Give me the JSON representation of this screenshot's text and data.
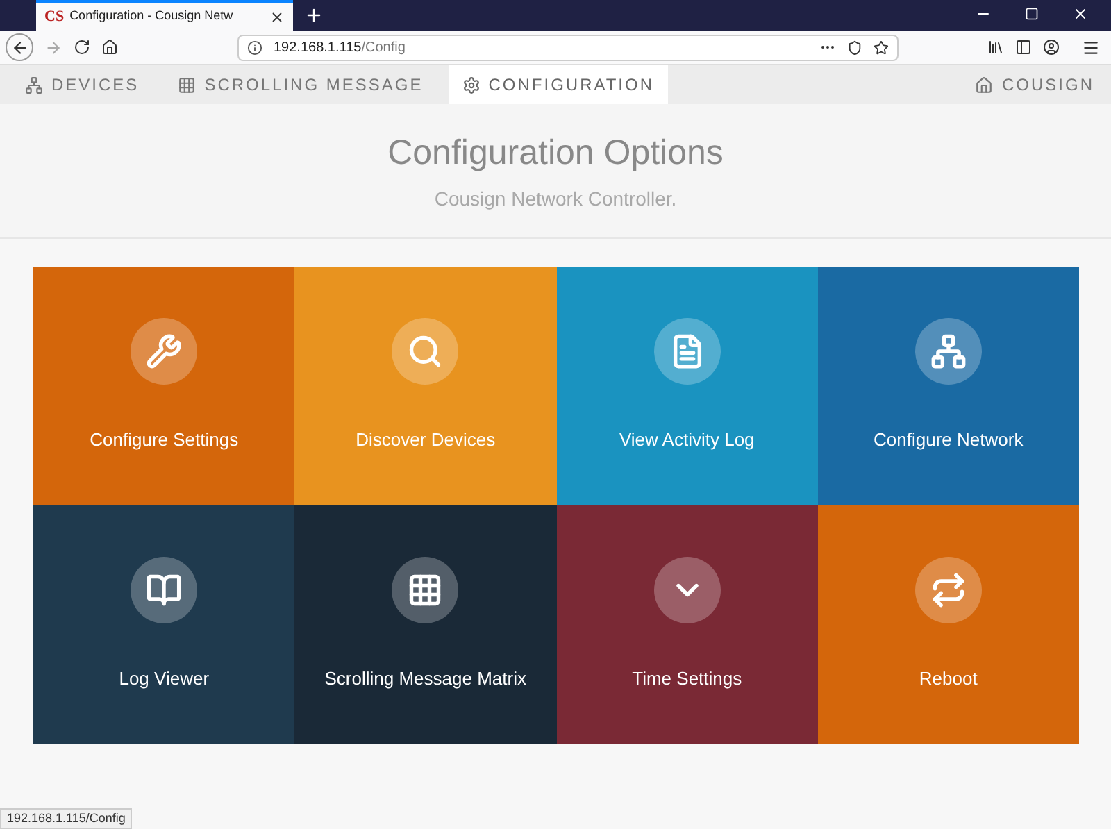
{
  "browser": {
    "tab_logo": "CS",
    "tab_title": "Configuration - Cousign Netw",
    "url_host": "192.168.1.115",
    "url_path": "/Config",
    "status_url": "192.168.1.115/Config"
  },
  "nav": {
    "items": [
      {
        "label": "DEVICES",
        "kind": "devices",
        "selected": false
      },
      {
        "label": "SCROLLING MESSAGE",
        "kind": "grid",
        "selected": false
      },
      {
        "label": "CONFIGURATION",
        "kind": "gears",
        "selected": true
      }
    ],
    "brand": "COUSIGN"
  },
  "header": {
    "title": "Configuration Options",
    "subtitle": "Cousign Network Controller."
  },
  "tiles": [
    {
      "label": "Configure Settings",
      "kind": "wrench",
      "color": "#d4660b"
    },
    {
      "label": "Discover Devices",
      "kind": "search",
      "color": "#e8931f"
    },
    {
      "label": "View Activity Log",
      "kind": "document",
      "color": "#1a93c0"
    },
    {
      "label": "Configure Network",
      "kind": "network",
      "color": "#1a6aa3"
    },
    {
      "label": "Log Viewer",
      "kind": "book",
      "color": "#1f3a4e"
    },
    {
      "label": "Scrolling Message Matrix",
      "kind": "grid",
      "color": "#1a2937"
    },
    {
      "label": "Time Settings",
      "kind": "chevron",
      "color": "#7a2935"
    },
    {
      "label": "Reboot",
      "kind": "repeat",
      "color": "#d4660b"
    }
  ]
}
